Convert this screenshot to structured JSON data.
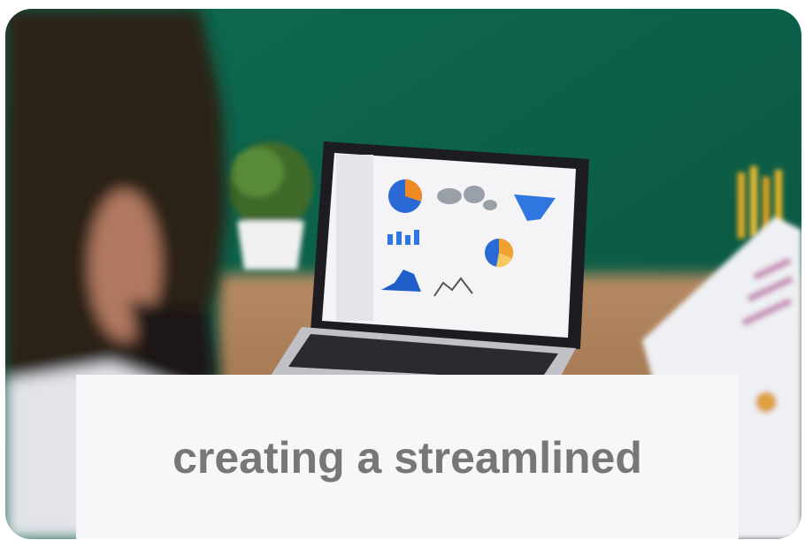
{
  "card": {
    "caption": "creating a streamlined",
    "caption_color": "#777777"
  },
  "photo": {
    "background_color": "#0b5e46",
    "icons": [
      "pie-chart-icon",
      "world-map-icon",
      "bar-chart-icon",
      "line-chart-icon"
    ]
  }
}
